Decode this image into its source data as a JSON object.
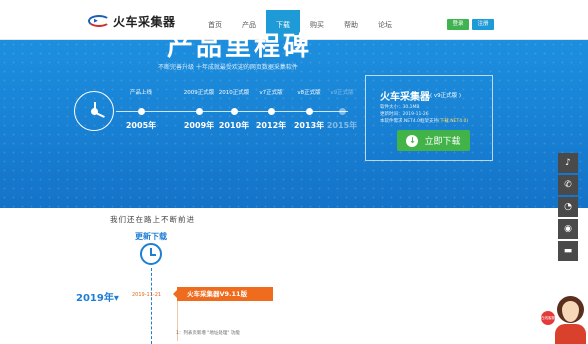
{
  "brand": {
    "name": "火车采集器"
  },
  "nav": {
    "items": [
      "首页",
      "产品",
      "下载",
      "购买",
      "帮助",
      "论坛"
    ],
    "active_index": 2,
    "login_label": "登录",
    "register_label": "注册"
  },
  "banner": {
    "title": "产品里程碑",
    "subtitle": "不断完善升级 十年成就最受欢迎的网页数据采集软件",
    "timeline": [
      {
        "label": "产品上线",
        "year": "2005年",
        "faded": false
      },
      {
        "label": "2009正式版",
        "year": "2009年",
        "faded": false
      },
      {
        "label": "2010正式版",
        "year": "2010年",
        "faded": false
      },
      {
        "label": "v7正式版",
        "year": "2012年",
        "faded": false
      },
      {
        "label": "v8正式版",
        "year": "2013年",
        "faded": false
      },
      {
        "label": "v9正式版",
        "year": "2015年",
        "faded": true
      }
    ]
  },
  "download": {
    "title": "火车采集器",
    "version": "( v9正式版 )",
    "size": "软件大小：30.1MB",
    "updated": "更新时间：2019-11-26",
    "req": "本软件需求.NET4.0框架支持",
    "req_link": "(下载.NET4.0)",
    "button_label": "立即下载",
    "accent": "#41b348"
  },
  "updates": {
    "slogan": "我们还在路上不断前进",
    "section_label": "更新下载",
    "year": "2019年▾",
    "date": "2019-11-21",
    "version_tag": "火车采集器V9.11版",
    "feature": "1：列表页新增 \"地址处理\" 功能"
  },
  "side_tools": [
    "bell-icon",
    "phone-icon",
    "wechat-icon",
    "weibo-icon",
    "chat-icon"
  ],
  "service": {
    "label": "在线客服"
  }
}
